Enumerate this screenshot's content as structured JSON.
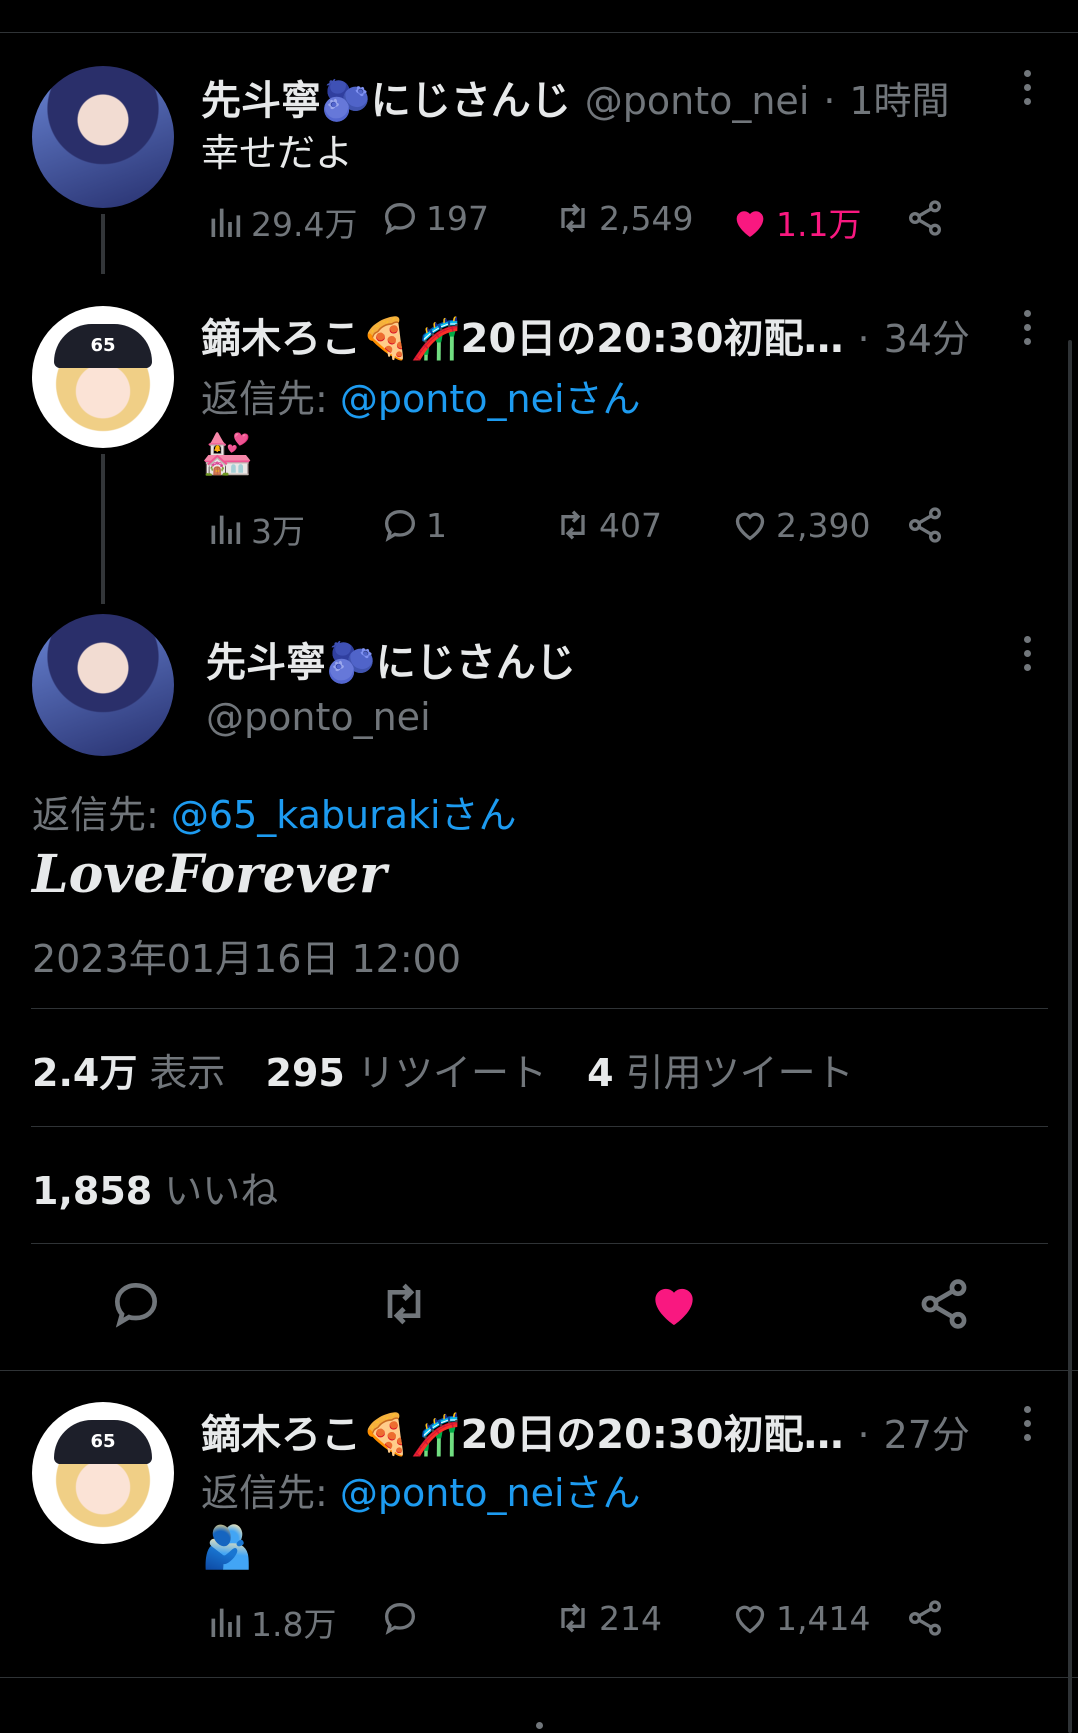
{
  "tweet1": {
    "name": "先斗寧🫐にじさんじ",
    "handle": "@ponto_nei",
    "dot": "·",
    "time": "1時間",
    "text": "幸せだよ",
    "views": "29.4万",
    "replies": "197",
    "retweets": "2,549",
    "likes": "1.1万",
    "liked": true
  },
  "tweet2": {
    "name": "鏑木ろこ🍕🎢20日の20:30初配…",
    "dot": "·",
    "time": "34分",
    "reply_prefix": "返信先: ",
    "reply_to": "@ponto_neiさん",
    "text": "💒",
    "views": "3万",
    "replies": "1",
    "retweets": "407",
    "likes": "2,390",
    "liked": false
  },
  "main": {
    "name": "先斗寧🫐にじさんじ",
    "handle": "@ponto_nei",
    "reply_prefix": "返信先: ",
    "reply_to": "@65_kaburakiさん",
    "text": "LoveForever",
    "timestamp": "2023年01月16日 12:00",
    "views_count": "2.4万",
    "views_label": "表示",
    "retweets_count": "295",
    "retweets_label": "リツイート",
    "quotes_count": "4",
    "quotes_label": "引用ツイート",
    "likes_count": "1,858",
    "likes_label": "いいね",
    "liked": true
  },
  "tweet3": {
    "name": "鏑木ろこ🍕🎢20日の20:30初配…",
    "dot": "·",
    "time": "27分",
    "reply_prefix": "返信先: ",
    "reply_to": "@ponto_neiさん",
    "text": "🫂",
    "views": "1.8万",
    "replies": "",
    "retweets": "214",
    "likes": "1,414",
    "liked": false
  },
  "avatars": {
    "nei": "avatar-ponto-nei",
    "roko": "avatar-kaburaki-roko",
    "cap_text": "65"
  },
  "colors": {
    "like": "#f91880",
    "link": "#1d9bf0",
    "muted": "#71767b",
    "text": "#e7e9ea",
    "bg": "#000000"
  }
}
